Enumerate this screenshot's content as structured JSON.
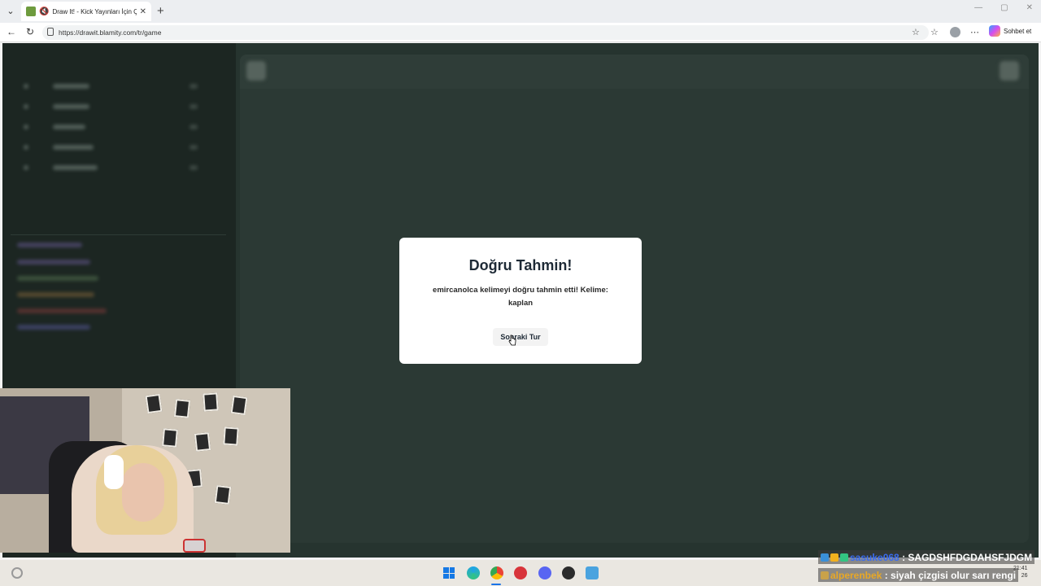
{
  "browser": {
    "tab_title": "Draw It! - Kick Yayınları İçin Ç",
    "url": "https://drawit.blamity.com/tr/game",
    "copilot_label": "Sohbet et",
    "window_controls": [
      "—",
      "▢",
      "✕"
    ]
  },
  "modal": {
    "title": "Doğru Tahmin!",
    "message": "emircanolca kelimeyi doğru tahmin etti! Kelime: kaplan",
    "button_label": "Sonraki Tur"
  },
  "chat_overlay": [
    {
      "user": "sasuke068",
      "separator": " : ",
      "text": "SAGDSHFDGDAHSFJDGM"
    },
    {
      "user": "alperenbek",
      "separator": " : ",
      "text": "siyah çizgisi olur sarı rengi"
    }
  ],
  "taskbar": {
    "clock_time": "21:41",
    "clock_date": "26"
  },
  "icons": {
    "tab_list": "chevron-down-icon",
    "back": "back-arrow-icon",
    "reload": "reload-icon",
    "favorite": "star-icon",
    "collections": "collections-icon",
    "more": "more-icon"
  },
  "colors": {
    "page_bg": "#26342f",
    "sidebar_bg": "#1c2622",
    "modal_bg": "#ffffff",
    "modal_title": "#1e2a36",
    "chat_user1": "#3a6cf0",
    "chat_user2": "#e9a825"
  }
}
